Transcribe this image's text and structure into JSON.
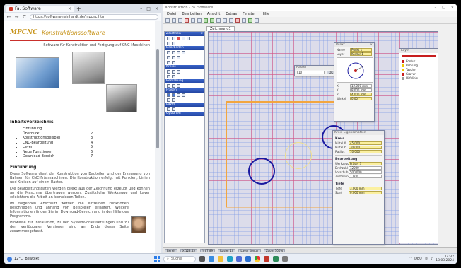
{
  "browser": {
    "tab_title": "Fa. Software",
    "tab_close": "×",
    "new_tab": "+",
    "url": "https://software-reinhardt.de/mpcnc.htm",
    "nav": {
      "back": "←",
      "forward": "→",
      "reload": "C"
    },
    "window_buttons": {
      "min": "–",
      "max": "□",
      "close": "×"
    },
    "site": {
      "logo": "MPCNC",
      "title": "Konstruktionssoftware",
      "subtitle": "Software für Konstruktion und Fertigung auf CNC-Maschinen",
      "contents_title": "Inhaltsverzeichnis",
      "contents": [
        {
          "label": "Einführung",
          "page": ""
        },
        {
          "label": "Überblick",
          "page": "2"
        },
        {
          "label": "Konstruktionsbeispiel",
          "page": "3"
        },
        {
          "label": "CNC-Bearbeitung",
          "page": "4"
        },
        {
          "label": "Layer",
          "page": "5"
        },
        {
          "label": "Neue Funktionen",
          "page": "6"
        },
        {
          "label": "Download-Bereich",
          "page": "7"
        }
      ],
      "para_title": "Einführung",
      "paragraphs": [
        "Diese Software dient der Konstruktion von Bauteilen und der Erzeugung von Bahnen für CNC-Fräsmaschinen. Die Konstruktion erfolgt mit Punkten, Linien und Kreisen auf einem Raster.",
        "Die Bearbeitungsdaten werden direkt aus der Zeichnung erzeugt und können an die Maschine übertragen werden. Zusätzliche Werkzeuge und Layer erleichtern die Arbeit an komplexen Teilen.",
        "Im folgenden Abschnitt werden die einzelnen Funktionen beschrieben und anhand von Beispielen erläutert. Weitere Informationen finden Sie im Download-Bereich und in der Hilfe des Programms.",
        "Hinweise zur Installation, zu den Systemvoraussetzungen und zu den verfügbaren Versionen sind am Ende dieser Seite zusammengefasst."
      ]
    }
  },
  "app": {
    "title": "Konstruktion - Fa. Software",
    "window_buttons": {
      "min": "–",
      "max": "□",
      "close": "×"
    },
    "menu": [
      "Datei",
      "Bearbeiten",
      "Ansicht",
      "Extras",
      "Fenster",
      "Hilfe"
    ],
    "doc_tab": "Zeichnung1",
    "tool_panel": {
      "sections": [
        "Zeichnen",
        "Bearbeiten",
        "Kreise",
        "Bemaßung",
        "Fräsen",
        "Layer",
        "Optionen"
      ],
      "close": "×"
    },
    "dialog_point": {
      "title": "Punkt",
      "close": "×",
      "fields": [
        {
          "label": "Name",
          "value": "Punkt 1"
        },
        {
          "label": "Layer",
          "value": "Kontur 1"
        },
        {
          "label": "X",
          "value": "12.000 mm"
        },
        {
          "label": "Y",
          "value": "8.000 mm"
        },
        {
          "label": "R",
          "value": "4.000 mm"
        },
        {
          "label": "Winkel",
          "value": "0.00 °"
        }
      ]
    },
    "dialog_small": {
      "title": "Raster",
      "value": "10",
      "ok": "OK"
    },
    "dialog_circle": {
      "title": "Kreis-Eigenschaften",
      "sections": [
        "Kreis",
        "Bearbeitung",
        "Tiefe"
      ],
      "fields": [
        {
          "label": "Mittel X",
          "value": "45.000"
        },
        {
          "label": "Mittel Y",
          "value": "30.000"
        },
        {
          "label": "Radius",
          "value": "10.000"
        },
        {
          "label": "Werkzeug",
          "value": "Fräser 3"
        },
        {
          "label": "Drehzahl",
          "value": "12000"
        },
        {
          "label": "Vorschub",
          "value": "500.000"
        },
        {
          "label": "Zustellung",
          "value": "1.000"
        },
        {
          "label": "Tiefe",
          "value": "3.000 mm"
        },
        {
          "label": "Start",
          "value": "0.000 mm"
        }
      ]
    },
    "layer_panel": {
      "title": "Layer",
      "layers": [
        {
          "name": "Kontur",
          "color": "#c81e1e"
        },
        {
          "name": "Bohrung",
          "color": "#f0c800"
        },
        {
          "name": "Tasche",
          "color": "#f0c800"
        },
        {
          "name": "Gravur",
          "color": "#c81e1e"
        },
        {
          "name": "Hilfslinie",
          "color": "#9a9a9a"
        }
      ]
    },
    "status": [
      "Bereit",
      "X 123.45",
      "Y 67.89",
      "Raster 10",
      "Layer Kontur",
      "Zoom 100%"
    ]
  },
  "taskbar": {
    "weather_temp": "12°C",
    "weather_text": "Bewölkt",
    "search_placeholder": "Suche",
    "time": "14:32",
    "date": "18.03.2024",
    "lang": "DEU"
  }
}
